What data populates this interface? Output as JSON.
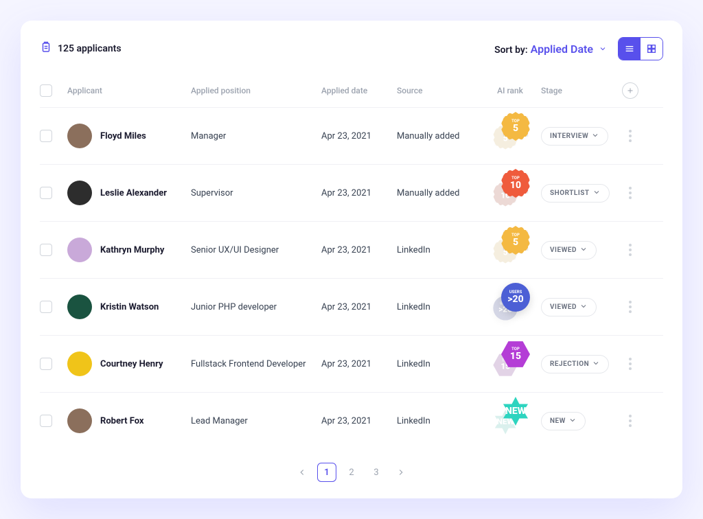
{
  "header": {
    "count_text": "125 applicants",
    "sort_label": "Sort by:",
    "sort_value": "Applied Date"
  },
  "columns": {
    "applicant": "Applicant",
    "position": "Applied position",
    "date": "Applied date",
    "source": "Source",
    "rank": "AI rank",
    "stage": "Stage"
  },
  "rows": [
    {
      "name": "Floyd Miles",
      "position": "Manager",
      "date": "Apr 23, 2021",
      "source": "Manually added",
      "badge": {
        "kind": "scallop",
        "top": "TOP",
        "value": "5",
        "color": "#f4b942"
      },
      "stage": "INTERVIEW",
      "avatar_bg": "#8b6f5c"
    },
    {
      "name": "Leslie Alexander",
      "position": "Supervisor",
      "date": "Apr 23, 2021",
      "source": "Manually added",
      "badge": {
        "kind": "scallop",
        "top": "TOP",
        "value": "10",
        "color": "#ef5b3c"
      },
      "stage": "SHORTLIST",
      "avatar_bg": "#2d2d2d"
    },
    {
      "name": "Kathryn Murphy",
      "position": "Senior UX/UI Designer",
      "date": "Apr 23, 2021",
      "source": "LinkedIn",
      "badge": {
        "kind": "scallop",
        "top": "TOP",
        "value": "5",
        "color": "#f4b942"
      },
      "stage": "VIEWED",
      "avatar_bg": "#c9a9d9"
    },
    {
      "name": "Kristin Watson",
      "position": "Junior PHP developer",
      "date": "Apr 23, 2021",
      "source": "LinkedIn",
      "badge": {
        "kind": "circle",
        "top": "USERS",
        "value": ">20",
        "color": "#4c5fd5"
      },
      "stage": "VIEWED",
      "avatar_bg": "#1a5340"
    },
    {
      "name": "Courtney Henry",
      "position": "Fullstack Frontend Developer",
      "date": "Apr 23, 2021",
      "source": "LinkedIn",
      "badge": {
        "kind": "hex",
        "top": "TOP",
        "value": "15",
        "color": "#b43dd6"
      },
      "stage": "REJECTION",
      "avatar_bg": "#f0c419"
    },
    {
      "name": "Robert Fox",
      "position": "Lead Manager",
      "date": "Apr 23, 2021",
      "source": "LinkedIn",
      "badge": {
        "kind": "star6",
        "top": "",
        "value": "NEW",
        "color": "#2dd4bf"
      },
      "stage": "NEW",
      "avatar_bg": "#8b6f5c"
    }
  ],
  "pagination": {
    "pages": [
      "1",
      "2",
      "3"
    ],
    "active": 0
  }
}
